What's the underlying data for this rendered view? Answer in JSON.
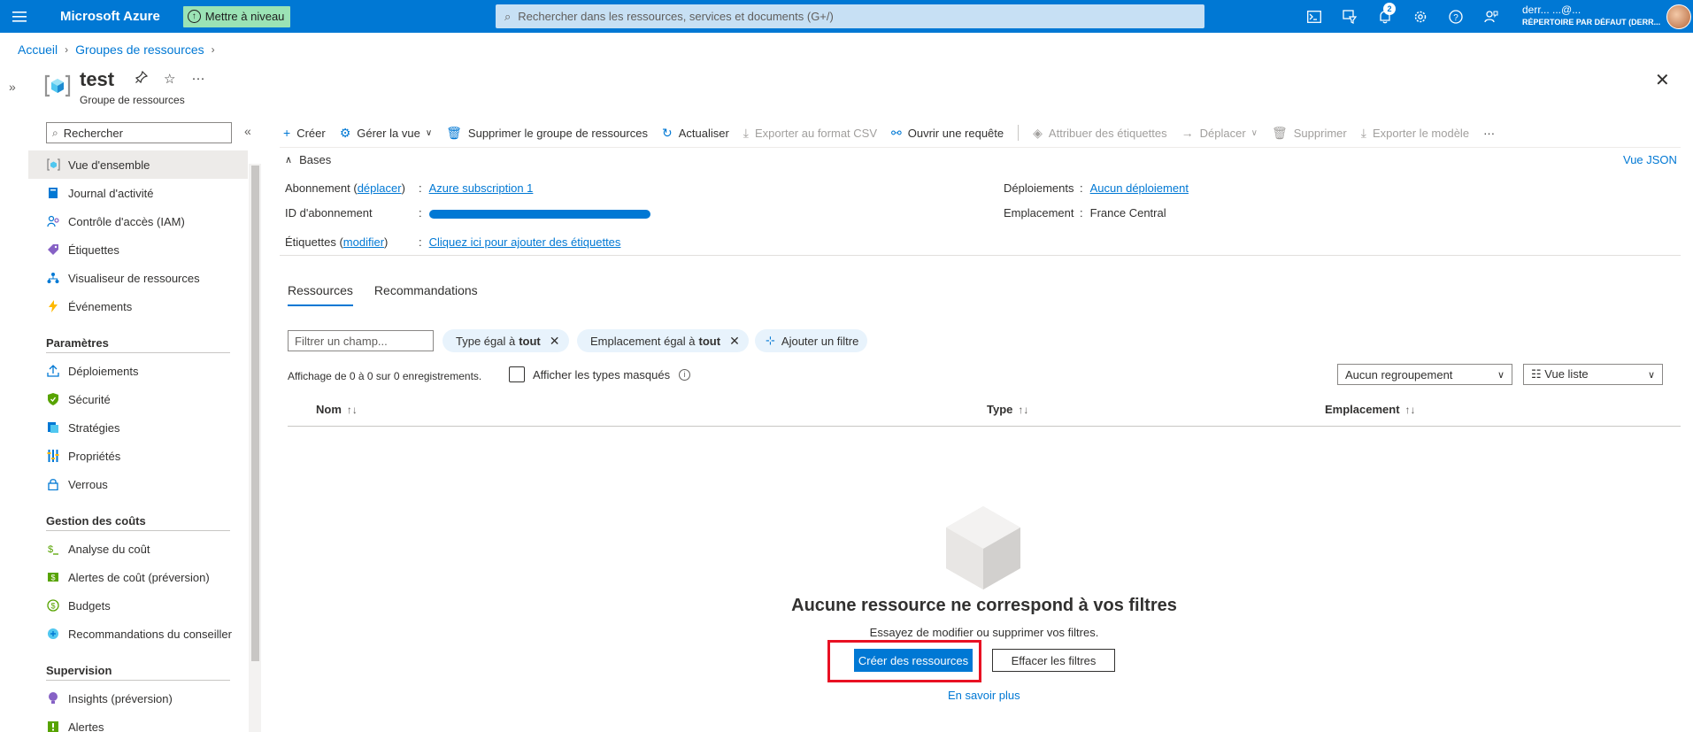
{
  "topbar": {
    "brand": "Microsoft Azure",
    "upgrade_label": "Mettre à niveau",
    "search_placeholder": "Rechercher dans les ressources, services et documents (G+/)",
    "notification_count": "2",
    "account_email": "derr...                     ...@...",
    "account_directory": "RÉPERTOIRE PAR DÉFAUT (DERR..."
  },
  "breadcrumb": {
    "items": [
      "Accueil",
      "Groupes de ressources"
    ]
  },
  "header": {
    "title": "test",
    "subtitle": "Groupe de ressources"
  },
  "sidebar": {
    "search_placeholder": "Rechercher",
    "items": [
      "Vue d'ensemble",
      "Journal d'activité",
      "Contrôle d'accès (IAM)",
      "Étiquettes",
      "Visualiseur de ressources",
      "Événements"
    ],
    "sections": [
      {
        "title": "Paramètres",
        "items": [
          "Déploiements",
          "Sécurité",
          "Stratégies",
          "Propriétés",
          "Verrous"
        ]
      },
      {
        "title": "Gestion des coûts",
        "items": [
          "Analyse du coût",
          "Alertes de coût (préversion)",
          "Budgets",
          "Recommandations du conseiller"
        ]
      },
      {
        "title": "Supervision",
        "items": [
          "Insights (préversion)",
          "Alertes"
        ]
      }
    ]
  },
  "toolbar": {
    "create": "Créer",
    "manage_view": "Gérer la vue",
    "delete_group": "Supprimer le groupe de ressources",
    "refresh": "Actualiser",
    "export_csv": "Exporter au format CSV",
    "open_query": "Ouvrir une requête",
    "assign_tags": "Attribuer des étiquettes",
    "move": "Déplacer",
    "delete": "Supprimer",
    "export_template": "Exporter le modèle",
    "more": "···"
  },
  "essentials": {
    "bases_label": "Bases",
    "json_view": "Vue JSON",
    "subscription_label": "Abonnement",
    "move_link": "déplacer",
    "subscription_value": "Azure subscription 1",
    "subscription_id_label": "ID d'abonnement",
    "tags_label": "Étiquettes",
    "modify_link": "modifier",
    "tags_value": "Cliquez ici pour ajouter des étiquettes",
    "deployments_label": "Déploiements",
    "deployments_value": "Aucun déploiement",
    "location_label": "Emplacement",
    "location_value": "France Central"
  },
  "tabs": [
    "Ressources",
    "Recommandations"
  ],
  "filters": {
    "field_placeholder": "Filtrer un champ...",
    "type_filter_prefix": "Type égal à",
    "type_filter_value": "tout",
    "location_filter_prefix": "Emplacement égal à",
    "location_filter_value": "tout",
    "add_filter": "Ajouter un filtre"
  },
  "list": {
    "records_text": "Affichage de 0 à 0 sur 0 enregistrements.",
    "show_hidden_types": "Afficher les types masqués",
    "grouping": "Aucun regroupement",
    "view_mode": "Vue liste",
    "columns": [
      "Nom",
      "Type",
      "Emplacement"
    ]
  },
  "empty_state": {
    "title": "Aucune ressource ne correspond à vos filtres",
    "subtitle": "Essayez de modifier ou supprimer vos filtres.",
    "create_button": "Créer des ressources",
    "clear_button": "Effacer les filtres",
    "learn_more": "En savoir plus"
  },
  "colors": {
    "accent": "#0078d4",
    "upgrade_bg": "#9be3b5",
    "highlight": "#e81123"
  }
}
